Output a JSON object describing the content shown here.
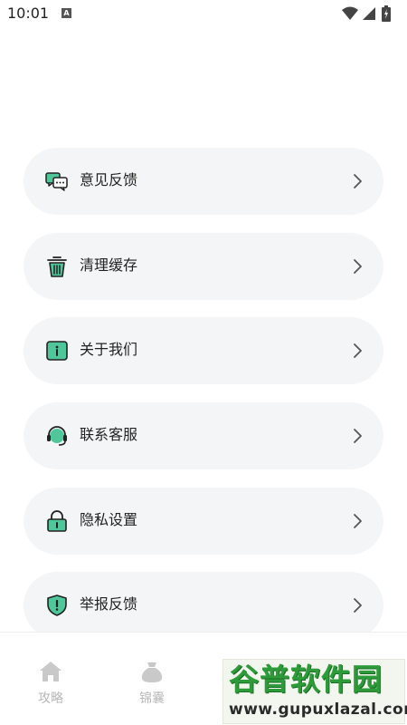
{
  "status_bar": {
    "time": "10:01",
    "notification_badge": "A"
  },
  "menu_items": [
    {
      "label": "意见反馈",
      "icon": "chat-bubbles-icon"
    },
    {
      "label": "清理缓存",
      "icon": "trash-icon"
    },
    {
      "label": "关于我们",
      "icon": "info-icon"
    },
    {
      "label": "联系客服",
      "icon": "headset-icon"
    },
    {
      "label": "隐私设置",
      "icon": "lock-icon"
    },
    {
      "label": "举报反馈",
      "icon": "shield-alert-icon"
    }
  ],
  "bottom_nav": [
    {
      "label": "攻略",
      "icon": "home-icon"
    },
    {
      "label": "锦囊",
      "icon": "bag-icon"
    }
  ],
  "watermark": {
    "title": "谷普软件园",
    "url": "www.gupuxlazal.com"
  },
  "colors": {
    "accent": "#4fc79a",
    "card_bg": "#f4f5f7",
    "nav_inactive": "#c0c0c0"
  }
}
